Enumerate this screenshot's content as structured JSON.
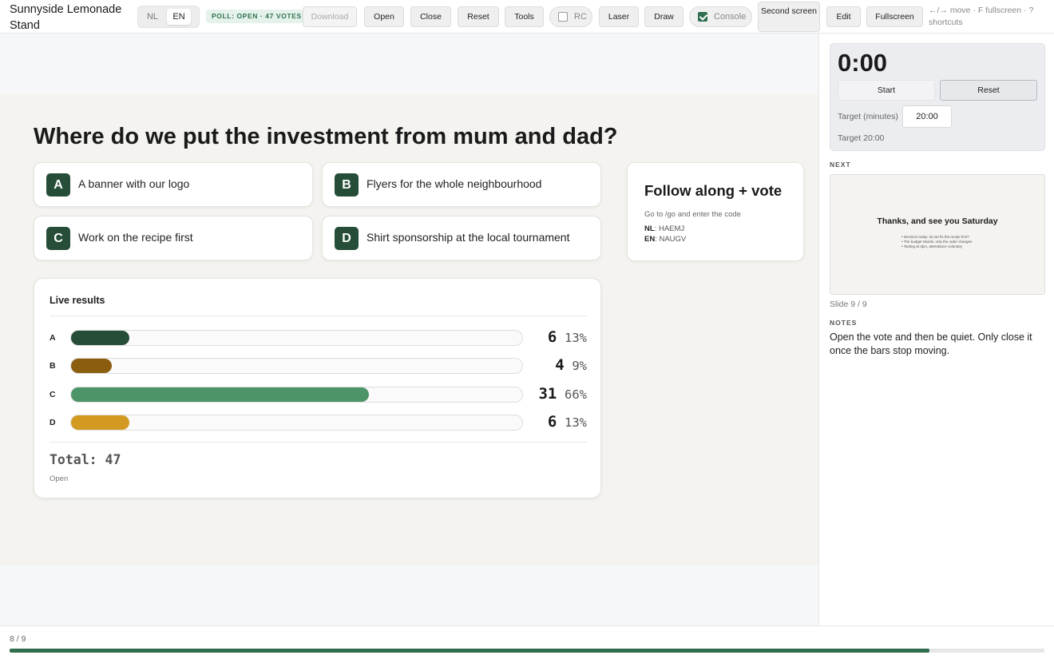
{
  "app": {
    "title": "Sunnyside Lemonade Stand"
  },
  "toolbar": {
    "lang": {
      "nl": "NL",
      "en": "EN",
      "active": "EN"
    },
    "poll_badge": "POLL: OPEN · 47 VOTES",
    "download": "Download",
    "open": "Open",
    "close": "Close",
    "reset": "Reset",
    "tools": "Tools",
    "rc": {
      "label": "RC",
      "checked": false
    },
    "laser": "Laser",
    "draw": "Draw",
    "console": {
      "label": "Console",
      "checked": true
    },
    "second_screen": "Second screen",
    "edit": "Edit",
    "fullscreen": "Fullscreen",
    "shortcuts_hint": "←/→ move · F fullscreen · ? shortcuts"
  },
  "slide": {
    "question": "Where do we put the investment from mum and dad?",
    "options": [
      {
        "letter": "A",
        "text": "A banner with our logo"
      },
      {
        "letter": "B",
        "text": "Flyers for the whole neighbourhood"
      },
      {
        "letter": "C",
        "text": "Work on the recipe first"
      },
      {
        "letter": "D",
        "text": "Shirt sponsorship at the local tournament"
      }
    ],
    "follow": {
      "title": "Follow along + vote",
      "subtitle": "Go to /go and enter the code",
      "codes": [
        {
          "lang": "NL",
          "code": "HAEMJ"
        },
        {
          "lang": "EN",
          "code": "NAUGV"
        }
      ]
    },
    "results": {
      "title": "Live results",
      "rows": [
        {
          "label": "A",
          "count": "6",
          "percent": "13%",
          "fraction": 0.13,
          "color": "#264d37"
        },
        {
          "label": "B",
          "count": "4",
          "percent": "9%",
          "fraction": 0.09,
          "color": "#8a5e0e"
        },
        {
          "label": "C",
          "count": "31",
          "percent": "66%",
          "fraction": 0.66,
          "color": "#4d9469"
        },
        {
          "label": "D",
          "count": "6",
          "percent": "13%",
          "fraction": 0.13,
          "color": "#d39a21"
        }
      ],
      "total": "Total: 47",
      "status": "Open"
    }
  },
  "panel": {
    "timer": {
      "display": "0:00",
      "start": "Start",
      "reset": "Reset",
      "target_label": "Target (minutes)",
      "target_value": "20:00",
      "target_note": "Target 20:00"
    },
    "next_heading": "NEXT",
    "next_slide": {
      "title": "Thanks, and see you Saturday",
      "bullets": [
        "Decision today: do we fix the recipe first?",
        "The budget stands, only the order changes",
        "Tasting at 3pm, attendance voluntary"
      ]
    },
    "slide_counter": "Slide 9 / 9",
    "notes_heading": "NOTES",
    "notes": "Open the vote and then be quiet. Only close it once the bars stop moving."
  },
  "footer": {
    "page": "8 / 9",
    "progress": 0.889
  }
}
